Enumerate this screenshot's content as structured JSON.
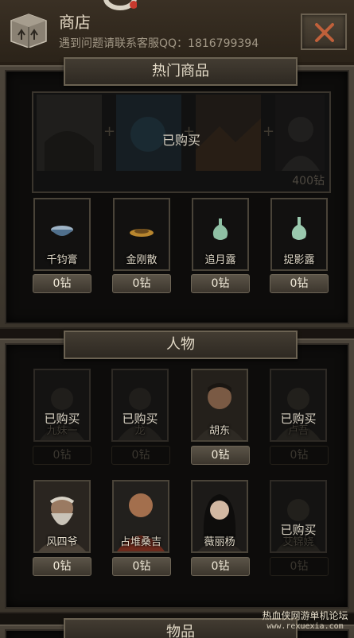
{
  "header": {
    "title": "商店",
    "subtitle": "遇到问题请联系客服QQ：1816799394",
    "box_icon": "box-icon",
    "close_icon": "close-icon"
  },
  "hot": {
    "tab_label": "热门商品",
    "bundle": {
      "status": "已购买",
      "price": "400钻"
    },
    "items": [
      {
        "name": "千钧膏",
        "price": "0钻",
        "icon": "bowl-icon"
      },
      {
        "name": "金刚散",
        "price": "0钻",
        "icon": "plate-icon"
      },
      {
        "name": "追月露",
        "price": "0钻",
        "icon": "vase-icon"
      },
      {
        "name": "捉影露",
        "price": "0钻",
        "icon": "vase-icon"
      }
    ]
  },
  "characters": {
    "tab_label": "人物",
    "rows": [
      [
        {
          "name": "九妹一",
          "price": "0钻",
          "status": "已购买"
        },
        {
          "name": "龙",
          "price": "0钻",
          "status": "已购买"
        },
        {
          "name": "胡东",
          "price": "0钻",
          "status": ""
        },
        {
          "name": "卢吾",
          "price": "0钻",
          "status": "已购买"
        }
      ],
      [
        {
          "name": "风四爷",
          "price": "0钻",
          "status": ""
        },
        {
          "name": "占堆桑吉",
          "price": "0钻",
          "status": ""
        },
        {
          "name": "薇丽杨",
          "price": "0钻",
          "status": ""
        },
        {
          "name": "艾锦娆",
          "price": "0钻",
          "status": "已购买"
        }
      ]
    ]
  },
  "items_section": {
    "tab_label": "物品"
  },
  "watermark": {
    "text": "热血侠网游单机论坛",
    "url": "www.rexuexia.com"
  },
  "colors": {
    "accent_close": "#c0603a",
    "panel_frame": "#4b443a",
    "text_light": "#e4d9c5"
  }
}
